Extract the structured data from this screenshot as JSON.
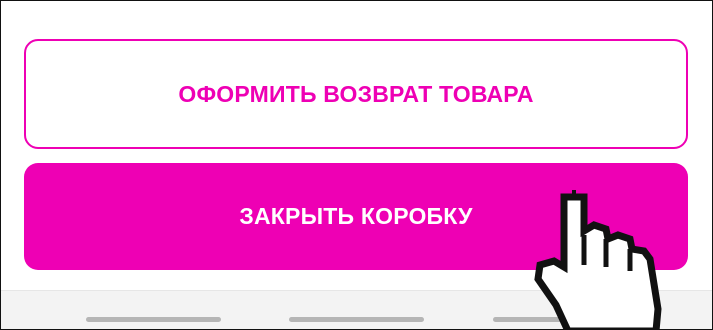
{
  "actions": {
    "return_label": "ОФОРМИТЬ ВОЗВРАТ ТОВАРА",
    "close_box_label": "ЗАКРЫТЬ КОРОБКУ"
  },
  "colors": {
    "accent": "#ee00b4",
    "bottom_bar": "#f3f3f3",
    "indicator": "#b5b5b5"
  },
  "icons": {
    "cursor": "hand-pointer-icon"
  }
}
